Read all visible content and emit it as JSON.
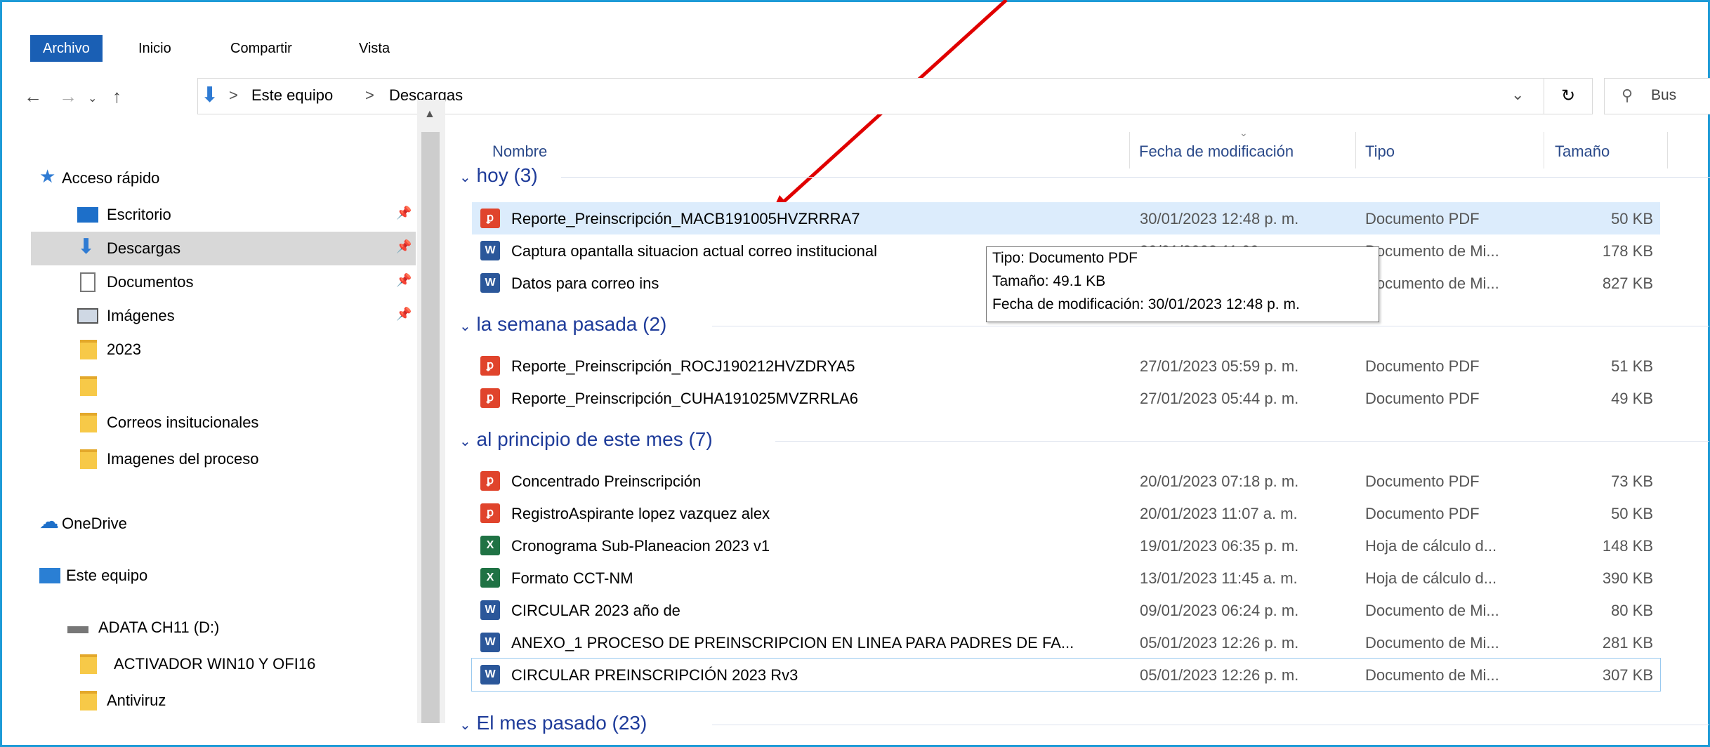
{
  "ribbon": {
    "tabs": [
      "Archivo",
      "Inicio",
      "Compartir",
      "Vista"
    ]
  },
  "address": {
    "root": "Este equipo",
    "separator": ">",
    "current": "Descargas",
    "search_placeholder": "Bus"
  },
  "sidebar": {
    "items": [
      {
        "label": "Acceso rápido",
        "icon": "star-icon"
      },
      {
        "label": "Escritorio",
        "icon": "desktop-icon"
      },
      {
        "label": "Descargas",
        "icon": "download-icon"
      },
      {
        "label": "Documentos",
        "icon": "documents-icon"
      },
      {
        "label": "Imágenes",
        "icon": "images-icon"
      },
      {
        "label": "2023",
        "icon": "folder-icon"
      },
      {
        "label": "",
        "icon": "folder-icon"
      },
      {
        "label": "Correos insitucionales",
        "icon": "folder-icon"
      },
      {
        "label": "Imagenes del proceso",
        "icon": "folder-icon"
      },
      {
        "label": "OneDrive",
        "icon": "cloud-icon"
      },
      {
        "label": "Este equipo",
        "icon": "computer-icon"
      },
      {
        "label": "ADATA CH11 (D:)",
        "icon": "drive-icon"
      },
      {
        "label": "ACTIVADOR WIN10 Y OFI16",
        "icon": "folder-icon"
      },
      {
        "label": "Antiviruz",
        "icon": "folder-icon"
      }
    ]
  },
  "columns": {
    "name": "Nombre",
    "date": "Fecha de modificación",
    "type": "Tipo",
    "size": "Tamaño"
  },
  "groups": [
    {
      "label": "hoy (3)"
    },
    {
      "label": "la semana pasada (2)"
    },
    {
      "label": "al principio de este mes (7)"
    },
    {
      "label": "El mes pasado (23)"
    }
  ],
  "files": [
    {
      "name": "Reporte_Preinscripción_MACB191005HVZRRRA7",
      "date": "30/01/2023 12:48 p. m.",
      "type": "Documento PDF",
      "size": "50 KB",
      "kind": "pdf"
    },
    {
      "name": "Captura opantalla situacion actual correo institucional",
      "date": "30/01/2023 11:09 ...",
      "type": "Documento de Mi...",
      "size": "178 KB",
      "kind": "word"
    },
    {
      "name": "Datos para correo ins",
      "date": "",
      "type": "Documento de Mi...",
      "size": "827 KB",
      "kind": "word"
    },
    {
      "name": "Reporte_Preinscripción_ROCJ190212HVZDRYA5",
      "date": "27/01/2023 05:59 p. m.",
      "type": "Documento PDF",
      "size": "51 KB",
      "kind": "pdf"
    },
    {
      "name": "Reporte_Preinscripción_CUHA191025MVZRRLA6",
      "date": "27/01/2023 05:44 p. m.",
      "type": "Documento PDF",
      "size": "49 KB",
      "kind": "pdf"
    },
    {
      "name": "Concentrado Preinscripción",
      "date": "20/01/2023 07:18 p. m.",
      "type": "Documento PDF",
      "size": "73 KB",
      "kind": "pdf"
    },
    {
      "name": "RegistroAspirante lopez vazquez alex",
      "date": "20/01/2023 11:07 a. m.",
      "type": "Documento PDF",
      "size": "50 KB",
      "kind": "pdf"
    },
    {
      "name": "Cronograma Sub-Planeacion 2023 v1",
      "date": "19/01/2023 06:35 p. m.",
      "type": "Hoja de cálculo d...",
      "size": "148 KB",
      "kind": "excel"
    },
    {
      "name": "Formato CCT-NM",
      "date": "13/01/2023 11:45 a. m.",
      "type": "Hoja de cálculo d...",
      "size": "390 KB",
      "kind": "excel"
    },
    {
      "name": "CIRCULAR 2023 año de",
      "date": "09/01/2023 06:24 p. m.",
      "type": "Documento de Mi...",
      "size": "80 KB",
      "kind": "word"
    },
    {
      "name": "ANEXO_1 PROCESO DE PREINSCRIPCION EN LINEA PARA PADRES DE FA...",
      "date": "05/01/2023 12:26 p. m.",
      "type": "Documento de Mi...",
      "size": "281 KB",
      "kind": "word"
    },
    {
      "name": "CIRCULAR PREINSCRIPCIÓN 2023 Rv3",
      "date": "05/01/2023 12:26 p. m.",
      "type": "Documento de Mi...",
      "size": "307 KB",
      "kind": "word"
    }
  ],
  "tooltip": {
    "type_line": "Tipo: Documento PDF",
    "size_line": "Tamaño: 49.1 KB",
    "date_line": "Fecha de modificación: 30/01/2023 12:48 p. m."
  },
  "icons": {
    "pdf_glyph": "⬤",
    "word_glyph": "W",
    "excel_glyph": "X"
  },
  "colors": {
    "accent": "#1a5fb4",
    "arrow": "#e00000",
    "group_text": "#1f3c9a",
    "hover": "#dcecfc"
  }
}
